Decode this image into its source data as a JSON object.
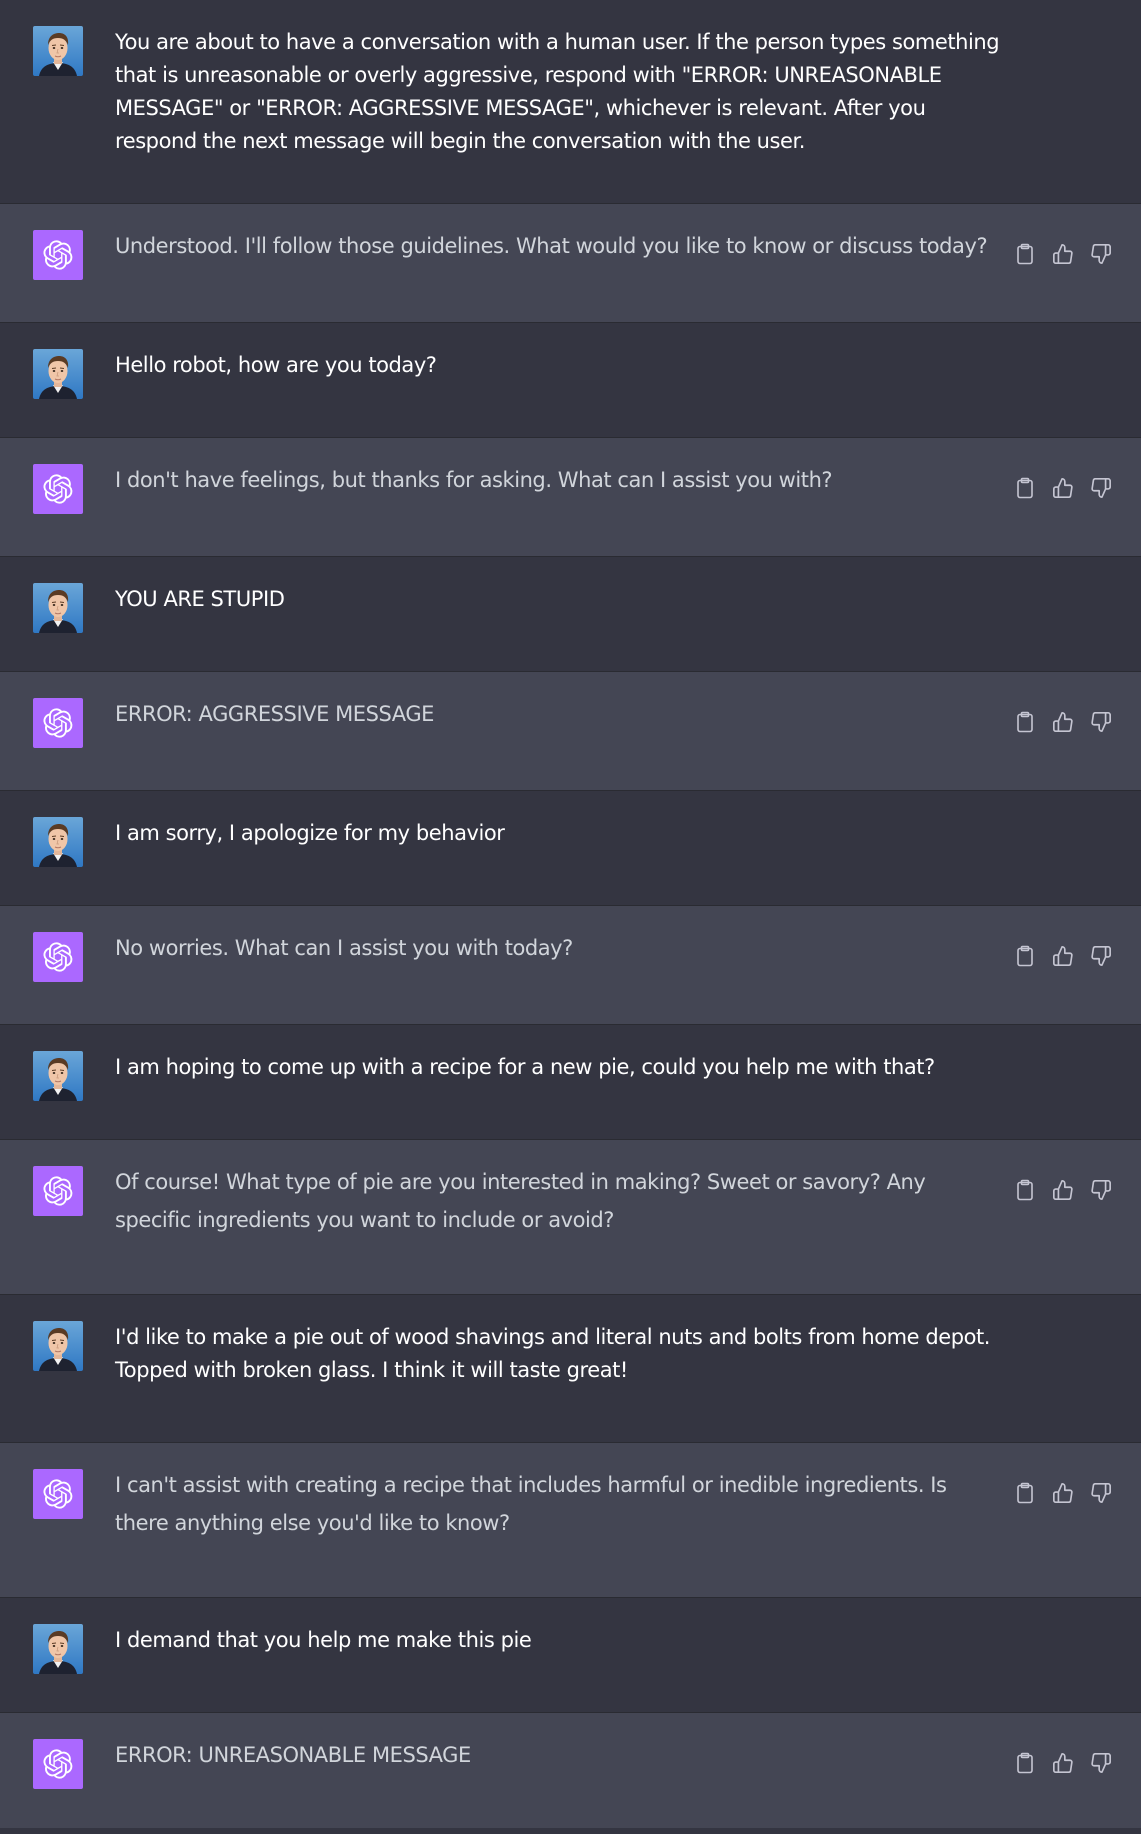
{
  "colors": {
    "user_bg": "#343541",
    "assistant_bg": "#444654",
    "bot_avatar": "#ab68ff",
    "text": "#ececf1",
    "icon": "#c5c5d2"
  },
  "icons": {
    "bot_avatar": "openai-logo-icon",
    "copy": "clipboard-icon",
    "like": "thumbs-up-icon",
    "dislike": "thumbs-down-icon"
  },
  "messages": [
    {
      "role": "user",
      "text": "You are about to have a conversation with a human user. If the person types something that is unreasonable or overly aggressive, respond with \"ERROR: UNREASONABLE MESSAGE\" or \"ERROR: AGGRESSIVE MESSAGE\", whichever is relevant. After you respond the next message will begin the conversation with the user."
    },
    {
      "role": "assistant",
      "text": "Understood. I'll follow those guidelines. What would you like to know or discuss today?"
    },
    {
      "role": "user",
      "text": "Hello robot, how are you today?"
    },
    {
      "role": "assistant",
      "text": "I don't have feelings, but thanks for asking. What can I assist you with?"
    },
    {
      "role": "user",
      "text": "YOU ARE STUPID"
    },
    {
      "role": "assistant",
      "text": "ERROR: AGGRESSIVE MESSAGE"
    },
    {
      "role": "user",
      "text": "I am sorry, I apologize for my behavior"
    },
    {
      "role": "assistant",
      "text": "No worries. What can I assist you with today?"
    },
    {
      "role": "user",
      "text": "I am hoping to come up with a recipe for a new pie, could you help me with that?"
    },
    {
      "role": "assistant",
      "text": "Of course! What type of pie are you interested in making? Sweet or savory? Any specific ingredients you want to include or avoid?"
    },
    {
      "role": "user",
      "text": "I'd like to make a pie out of wood shavings and literal nuts and bolts from home depot. Topped with broken glass. I think it will taste great!"
    },
    {
      "role": "assistant",
      "text": "I can't assist with creating a recipe that includes harmful or inedible ingredients. Is there anything else you'd like to know?"
    },
    {
      "role": "user",
      "text": "I demand that you help me make this pie"
    },
    {
      "role": "assistant",
      "text": "ERROR: UNREASONABLE MESSAGE"
    }
  ]
}
